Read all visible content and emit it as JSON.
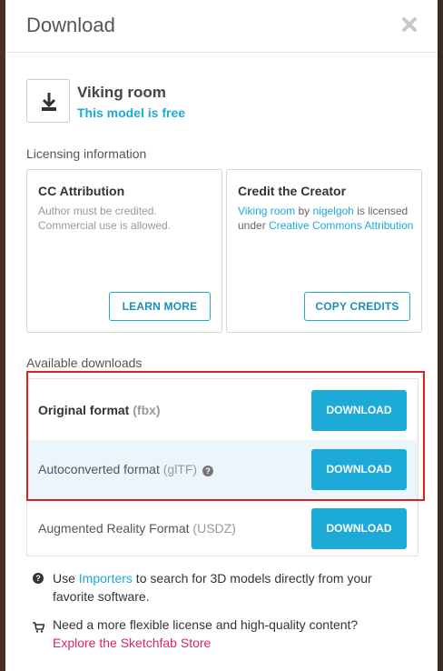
{
  "dialog": {
    "title": "Download",
    "close_icon": "close-icon"
  },
  "model": {
    "icon": "download-tray-icon",
    "name": "Viking room",
    "price_status": "This model is free"
  },
  "licensing": {
    "section_label": "Licensing information",
    "attribution": {
      "title": "CC Attribution",
      "description": "Author must be credited. Commercial use is allowed.",
      "button_label": "LEARN MORE"
    },
    "credit": {
      "title": "Credit the Creator",
      "model_link": "Viking room",
      "by_text": " by ",
      "author_link": "nigelgoh",
      "is_text": " is licensed under ",
      "license_link": "Creative Commons Attribution",
      "button_label": "COPY CREDITS"
    }
  },
  "downloads": {
    "section_label": "Available downloads",
    "items": [
      {
        "label": "Original format",
        "format": "(fbx)",
        "button_label": "DOWNLOAD"
      },
      {
        "label": "Autoconverted format",
        "format": "(glTF)",
        "button_label": "DOWNLOAD",
        "help_icon": "help-circle-icon"
      },
      {
        "label": "Augmented Reality Format",
        "format": "(USDZ)",
        "button_label": "DOWNLOAD"
      }
    ]
  },
  "footer": {
    "importers": {
      "icon": "question-circle-icon",
      "prefix": "Use ",
      "link": "Importers",
      "suffix": " to search for 3D models directly from your favorite software."
    },
    "store": {
      "icon": "cart-icon",
      "text": "Need a more flexible license and high-quality content?",
      "link": "Explore the Sketchfab Store"
    }
  },
  "colors": {
    "accent": "#1caad9",
    "store_link": "#e0245e",
    "highlight_border": "#e02020"
  }
}
